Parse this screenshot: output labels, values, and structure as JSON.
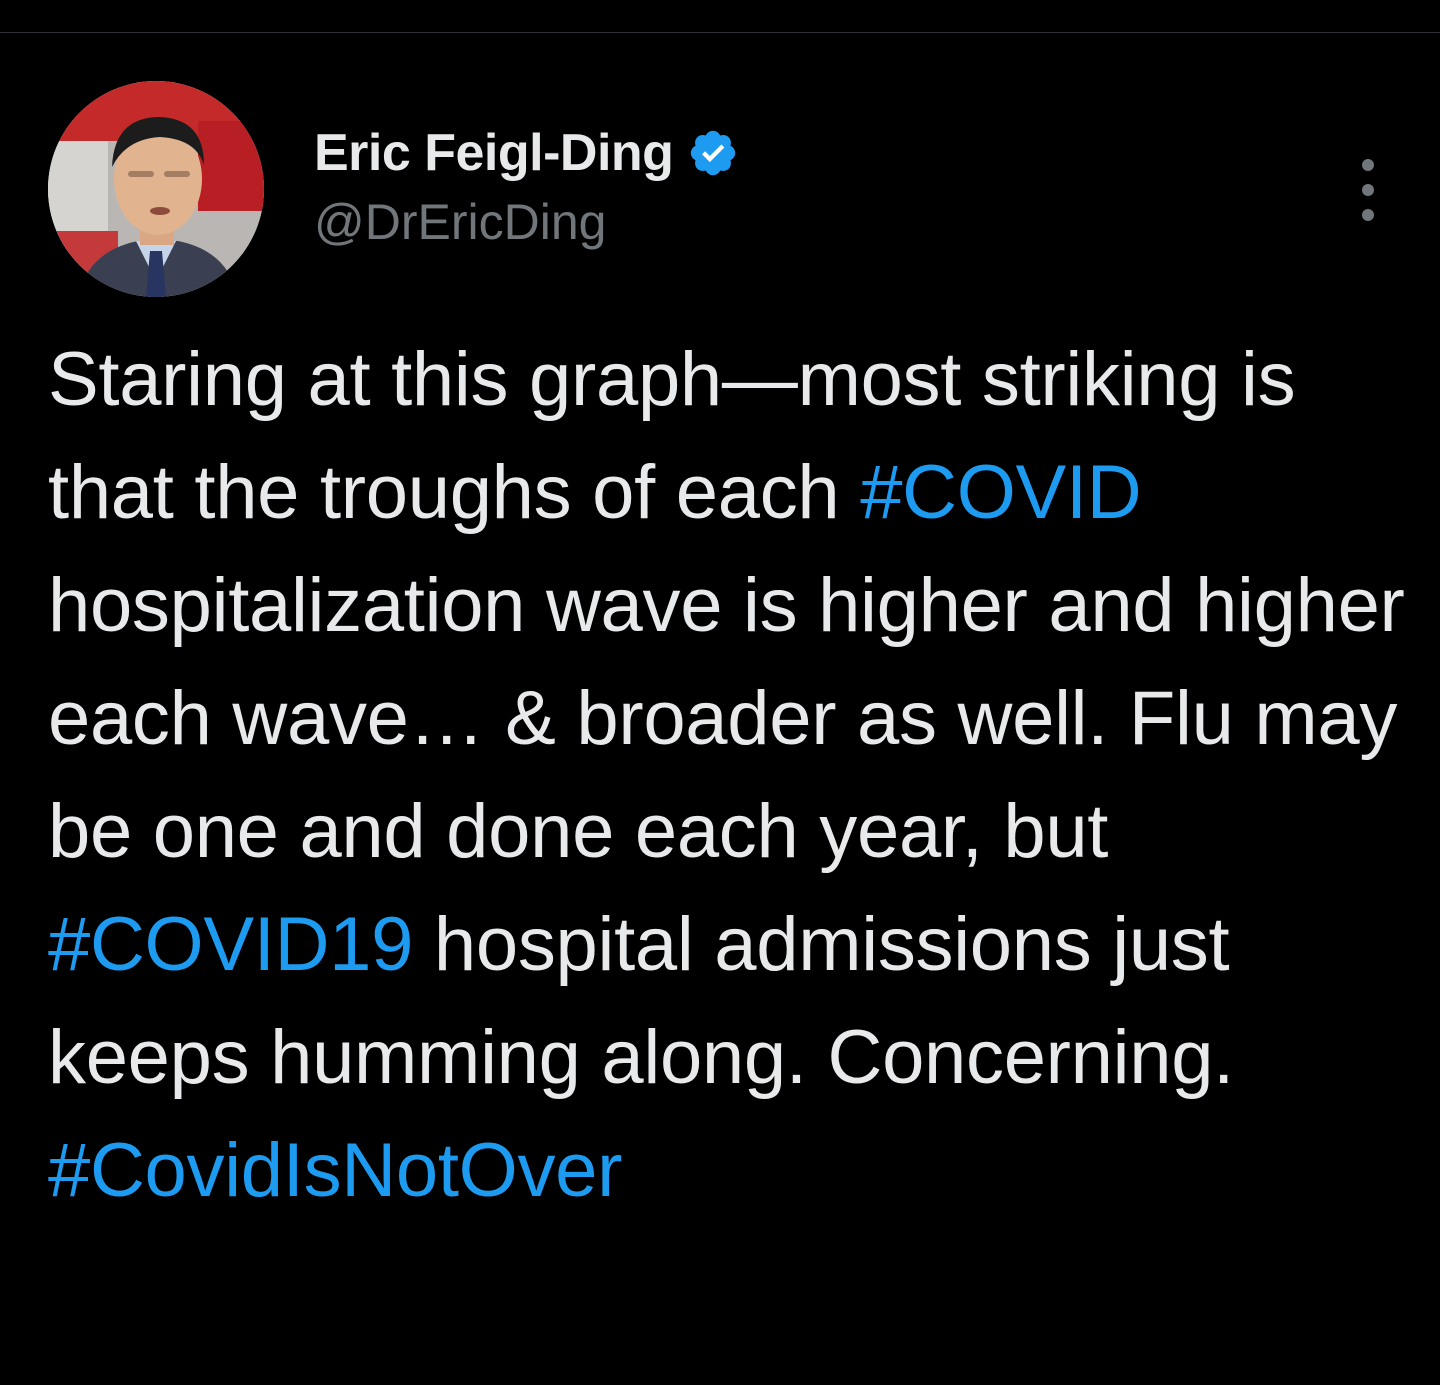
{
  "author": {
    "display_name": "Eric Feigl-Ding",
    "handle": "@DrEricDing",
    "verified_icon": "verified-badge-icon",
    "avatar_icon": "profile-photo"
  },
  "menu": {
    "icon": "more-options-icon"
  },
  "tweet": {
    "segments": [
      {
        "text": "Staring at this graph—most striking is that the troughs of each ",
        "type": "text"
      },
      {
        "text": "#COVID",
        "type": "hashtag"
      },
      {
        "text": " hospitalization wave is higher and higher each wave… & broader as well. Flu may be one and done each year, but ",
        "type": "text"
      },
      {
        "text": "#COVID19",
        "type": "hashtag"
      },
      {
        "text": " hospital admissions just keeps humming along. Concerning. ",
        "type": "text"
      },
      {
        "text": "#CovidIsNotOver",
        "type": "hashtag"
      }
    ]
  },
  "colors": {
    "background": "#000000",
    "primary_text": "#e7e9ea",
    "secondary_text": "#71767b",
    "link": "#1d9bf0",
    "divider": "#2f3336"
  }
}
